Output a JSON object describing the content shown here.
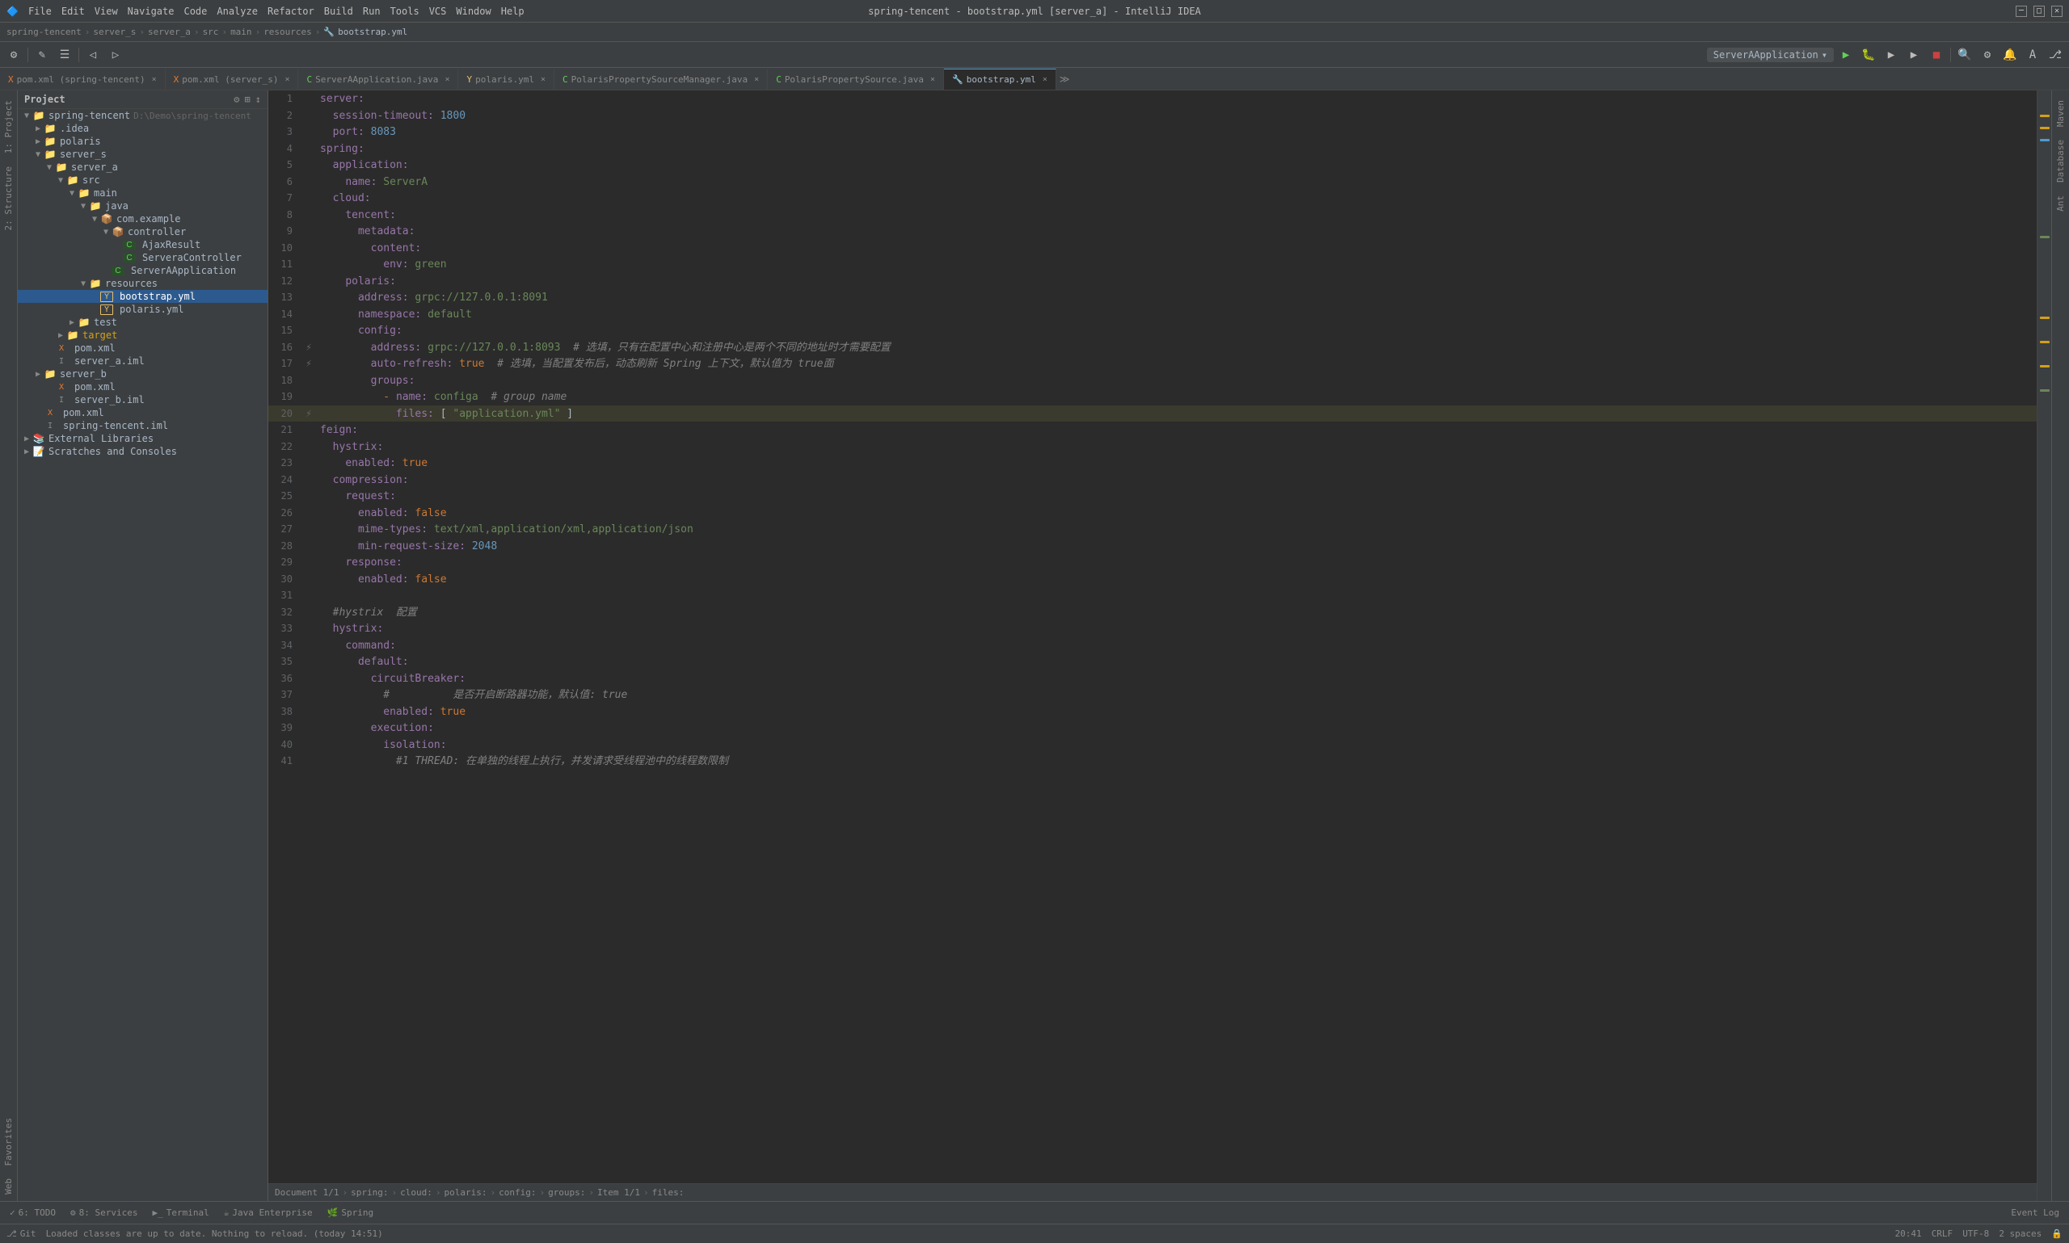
{
  "titleBar": {
    "menuItems": [
      "File",
      "Edit",
      "View",
      "Navigate",
      "Code",
      "Analyze",
      "Refactor",
      "Build",
      "Run",
      "Tools",
      "VCS",
      "Window",
      "Help"
    ],
    "title": "spring-tencent - bootstrap.yml [server_a] - IntelliJ IDEA",
    "controls": [
      "─",
      "□",
      "✕"
    ]
  },
  "breadcrumb": {
    "parts": [
      "spring-tencent",
      "server_s",
      "server_a",
      "src",
      "main",
      "resources",
      "bootstrap.yml"
    ]
  },
  "tabs": [
    {
      "label": "pom.xml (spring-tencent)",
      "icon": "xml",
      "active": false
    },
    {
      "label": "pom.xml (server_s)",
      "icon": "xml",
      "active": false
    },
    {
      "label": "ServerAApplication.java",
      "icon": "java",
      "active": false
    },
    {
      "label": "polaris.yml",
      "icon": "yml",
      "active": false
    },
    {
      "label": "PolarisPropertySourceManager.java",
      "icon": "java",
      "active": false
    },
    {
      "label": "PolarisPropertySource.java",
      "icon": "java",
      "active": false
    },
    {
      "label": "bootstrap.yml",
      "icon": "yml",
      "active": true
    }
  ],
  "sidebar": {
    "title": "Project",
    "tree": [
      {
        "id": 1,
        "indent": 0,
        "type": "dir",
        "label": "spring-tencent",
        "suffix": "D:\\Demo\\spring-tencent",
        "arrow": "▼",
        "icon": "📁"
      },
      {
        "id": 2,
        "indent": 1,
        "type": "dir",
        "label": ".idea",
        "arrow": "▶",
        "icon": "📁"
      },
      {
        "id": 3,
        "indent": 1,
        "type": "dir",
        "label": "polaris",
        "arrow": "▶",
        "icon": "📁"
      },
      {
        "id": 4,
        "indent": 1,
        "type": "dir",
        "label": "server_s",
        "arrow": "▼",
        "icon": "📁"
      },
      {
        "id": 5,
        "indent": 2,
        "type": "dir",
        "label": "server_a",
        "arrow": "▼",
        "icon": "📁"
      },
      {
        "id": 6,
        "indent": 3,
        "type": "dir",
        "label": "src",
        "arrow": "▼",
        "icon": "📁"
      },
      {
        "id": 7,
        "indent": 4,
        "type": "dir",
        "label": "main",
        "arrow": "▼",
        "icon": "📁"
      },
      {
        "id": 8,
        "indent": 5,
        "type": "dir",
        "label": "java",
        "arrow": "▼",
        "icon": "📁"
      },
      {
        "id": 9,
        "indent": 6,
        "type": "dir",
        "label": "com.example",
        "arrow": "▼",
        "icon": "📦"
      },
      {
        "id": 10,
        "indent": 7,
        "type": "dir",
        "label": "controller",
        "arrow": "▼",
        "icon": "📦"
      },
      {
        "id": 11,
        "indent": 8,
        "type": "java",
        "label": "AjaxResult",
        "arrow": "",
        "icon": "C"
      },
      {
        "id": 12,
        "indent": 8,
        "type": "java",
        "label": "ServeraController",
        "arrow": "",
        "icon": "C"
      },
      {
        "id": 13,
        "indent": 7,
        "type": "java",
        "label": "ServerAApplication",
        "arrow": "",
        "icon": "C"
      },
      {
        "id": 14,
        "indent": 5,
        "type": "dir",
        "label": "resources",
        "arrow": "▼",
        "icon": "📁"
      },
      {
        "id": 15,
        "indent": 6,
        "type": "yml",
        "label": "bootstrap.yml",
        "arrow": "",
        "icon": "Y",
        "selected": true
      },
      {
        "id": 16,
        "indent": 6,
        "type": "yml",
        "label": "polaris.yml",
        "arrow": "",
        "icon": "Y"
      },
      {
        "id": 17,
        "indent": 4,
        "type": "dir",
        "label": "test",
        "arrow": "▶",
        "icon": "📁"
      },
      {
        "id": 18,
        "indent": 3,
        "type": "dir",
        "label": "target",
        "arrow": "▶",
        "icon": "📁"
      },
      {
        "id": 19,
        "indent": 2,
        "type": "xml",
        "label": "pom.xml",
        "arrow": "",
        "icon": "X"
      },
      {
        "id": 20,
        "indent": 2,
        "type": "iml",
        "label": "server_a.iml",
        "arrow": "",
        "icon": "I"
      },
      {
        "id": 21,
        "indent": 1,
        "type": "dir",
        "label": "server_b",
        "arrow": "▶",
        "icon": "📁"
      },
      {
        "id": 22,
        "indent": 2,
        "type": "xml",
        "label": "pom.xml",
        "arrow": "",
        "icon": "X"
      },
      {
        "id": 23,
        "indent": 2,
        "type": "iml",
        "label": "server_b.iml",
        "arrow": "",
        "icon": "I"
      },
      {
        "id": 24,
        "indent": 1,
        "type": "xml",
        "label": "pom.xml",
        "arrow": "",
        "icon": "X"
      },
      {
        "id": 25,
        "indent": 1,
        "type": "iml",
        "label": "spring-tencent.iml",
        "arrow": "",
        "icon": "I"
      },
      {
        "id": 26,
        "indent": 0,
        "type": "dir",
        "label": "External Libraries",
        "arrow": "▶",
        "icon": "📚"
      },
      {
        "id": 27,
        "indent": 0,
        "type": "dir",
        "label": "Scratches and Consoles",
        "arrow": "▶",
        "icon": "📝"
      }
    ]
  },
  "editor": {
    "lines": [
      {
        "num": 1,
        "content": "server:",
        "gutter": ""
      },
      {
        "num": 2,
        "content": "  session-timeout: 1800",
        "gutter": ""
      },
      {
        "num": 3,
        "content": "  port: 8083",
        "gutter": ""
      },
      {
        "num": 4,
        "content": "spring:",
        "gutter": ""
      },
      {
        "num": 5,
        "content": "  application:",
        "gutter": ""
      },
      {
        "num": 6,
        "content": "    name: ServerA",
        "gutter": ""
      },
      {
        "num": 7,
        "content": "  cloud:",
        "gutter": ""
      },
      {
        "num": 8,
        "content": "    tencent:",
        "gutter": ""
      },
      {
        "num": 9,
        "content": "      metadata:",
        "gutter": ""
      },
      {
        "num": 10,
        "content": "        content:",
        "gutter": ""
      },
      {
        "num": 11,
        "content": "          env: green",
        "gutter": ""
      },
      {
        "num": 12,
        "content": "    polaris:",
        "gutter": ""
      },
      {
        "num": 13,
        "content": "      address: grpc://127.0.0.1:8091",
        "gutter": ""
      },
      {
        "num": 14,
        "content": "      namespace: default",
        "gutter": ""
      },
      {
        "num": 15,
        "content": "      config:",
        "gutter": ""
      },
      {
        "num": 16,
        "content": "        address: grpc://127.0.0.1:8093  # 选填，只有在配置中心和注册中心是两个不同的地址时才需要配置",
        "gutter": ""
      },
      {
        "num": 17,
        "content": "        auto-refresh: true  # 选填，当配置发布后，动态刷新 Spring 上下文，默认值为 true面",
        "gutter": ""
      },
      {
        "num": 18,
        "content": "        groups:",
        "gutter": ""
      },
      {
        "num": 19,
        "content": "          - name: configa  # group name",
        "gutter": ""
      },
      {
        "num": 20,
        "content": "            files: [ \"application.yml\" ]",
        "gutter": "highlight"
      },
      {
        "num": 21,
        "content": "feign:",
        "gutter": ""
      },
      {
        "num": 22,
        "content": "  hystrix:",
        "gutter": ""
      },
      {
        "num": 23,
        "content": "    enabled: true",
        "gutter": ""
      },
      {
        "num": 24,
        "content": "  compression:",
        "gutter": ""
      },
      {
        "num": 25,
        "content": "    request:",
        "gutter": ""
      },
      {
        "num": 26,
        "content": "      enabled: false",
        "gutter": ""
      },
      {
        "num": 27,
        "content": "      mime-types: text/xml,application/xml,application/json",
        "gutter": ""
      },
      {
        "num": 28,
        "content": "      min-request-size: 2048",
        "gutter": ""
      },
      {
        "num": 29,
        "content": "    response:",
        "gutter": ""
      },
      {
        "num": 30,
        "content": "      enabled: false",
        "gutter": ""
      },
      {
        "num": 31,
        "content": "",
        "gutter": ""
      },
      {
        "num": 32,
        "content": "  #hystrix  配置",
        "gutter": ""
      },
      {
        "num": 33,
        "content": "  hystrix:",
        "gutter": ""
      },
      {
        "num": 34,
        "content": "    command:",
        "gutter": ""
      },
      {
        "num": 35,
        "content": "      default:",
        "gutter": ""
      },
      {
        "num": 36,
        "content": "        circuitBreaker:",
        "gutter": ""
      },
      {
        "num": 37,
        "content": "          #          是否开启断路器功能，默认值: true",
        "gutter": ""
      },
      {
        "num": 38,
        "content": "          enabled: true",
        "gutter": ""
      },
      {
        "num": 39,
        "content": "        execution:",
        "gutter": ""
      },
      {
        "num": 40,
        "content": "          isolation:",
        "gutter": ""
      },
      {
        "num": 41,
        "content": "            #1 THREAD: 在单独的线程上执行，并发请求受线程池中的线程数限制",
        "gutter": ""
      }
    ]
  },
  "bottomBreadcrumb": {
    "parts": [
      "Document 1/1",
      "spring:",
      "cloud:",
      "polaris:",
      "config:",
      "groups:",
      "Item 1/1",
      "files:"
    ]
  },
  "statusBar": {
    "todo": "6: TODO",
    "services": "8: Services",
    "terminal": "Terminal",
    "javaEnterprise": "Java Enterprise",
    "spring": "Spring",
    "eventLog": "Event Log",
    "position": "20:41",
    "lineSeparator": "CRLF",
    "encoding": "UTF-8",
    "indent": "2 spaces"
  },
  "notification": "Loaded classes are up to date. Nothing to reload. (today 14:51)",
  "sideTabsRight": [
    "Maven",
    "Database",
    "Ant"
  ],
  "sideTabsLeft": [
    "1: Project",
    "2: Structure",
    "Favorites",
    "Web"
  ],
  "runConfig": "ServerAApplication"
}
